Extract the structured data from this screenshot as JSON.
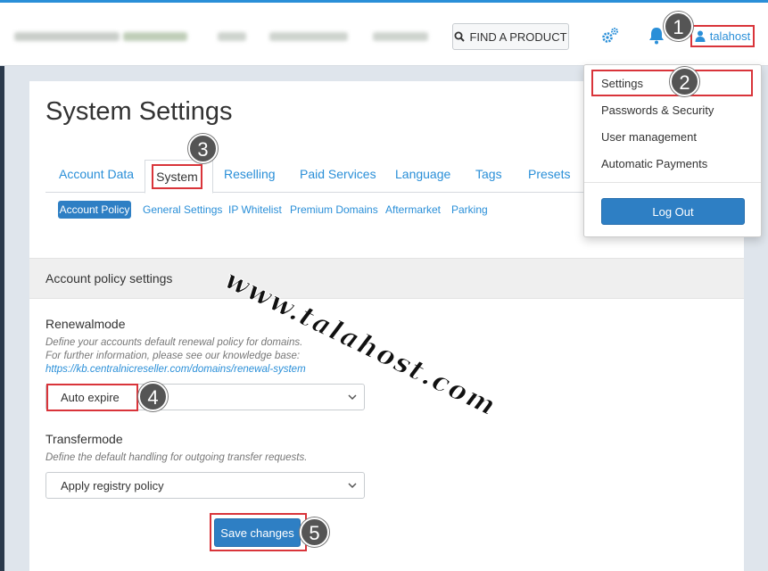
{
  "header": {
    "find_button_label": "FIND A PRODUCT",
    "user_label": "talahost"
  },
  "page": {
    "title": "System Settings"
  },
  "tabs": [
    {
      "label": "Account Data"
    },
    {
      "label": "System"
    },
    {
      "label": "Reselling"
    },
    {
      "label": "Paid Services"
    },
    {
      "label": "Language"
    },
    {
      "label": "Tags"
    },
    {
      "label": "Presets"
    }
  ],
  "subtabs": [
    {
      "label": "Account Policy"
    },
    {
      "label": "General Settings"
    },
    {
      "label": "IP Whitelist"
    },
    {
      "label": "Premium Domains"
    },
    {
      "label": "Aftermarket"
    },
    {
      "label": "Parking"
    }
  ],
  "section": {
    "title": "Account policy settings"
  },
  "renewal": {
    "label": "Renewalmode",
    "help_line1": "Define your accounts default renewal policy for domains.",
    "help_line2": "For further information, please see our knowledge base:",
    "help_link": "https://kb.centralnicreseller.com/domains/renewal-system",
    "value": "Auto expire"
  },
  "transfer": {
    "label": "Transfermode",
    "help": "Define the default handling for outgoing transfer requests.",
    "value": "Apply registry policy"
  },
  "save_label": "Save changes",
  "dropdown": {
    "items": [
      {
        "label": "Settings"
      },
      {
        "label": "Passwords & Security"
      },
      {
        "label": "User management"
      },
      {
        "label": "Automatic Payments"
      }
    ],
    "logout_label": "Log Out"
  },
  "badges": [
    "1",
    "2",
    "3",
    "4",
    "5"
  ],
  "watermark": "www.talahost.com",
  "colors": {
    "accent": "#2a8fd8",
    "button": "#2e7fc4",
    "highlight": "#d9343a",
    "badge": "#555555"
  }
}
